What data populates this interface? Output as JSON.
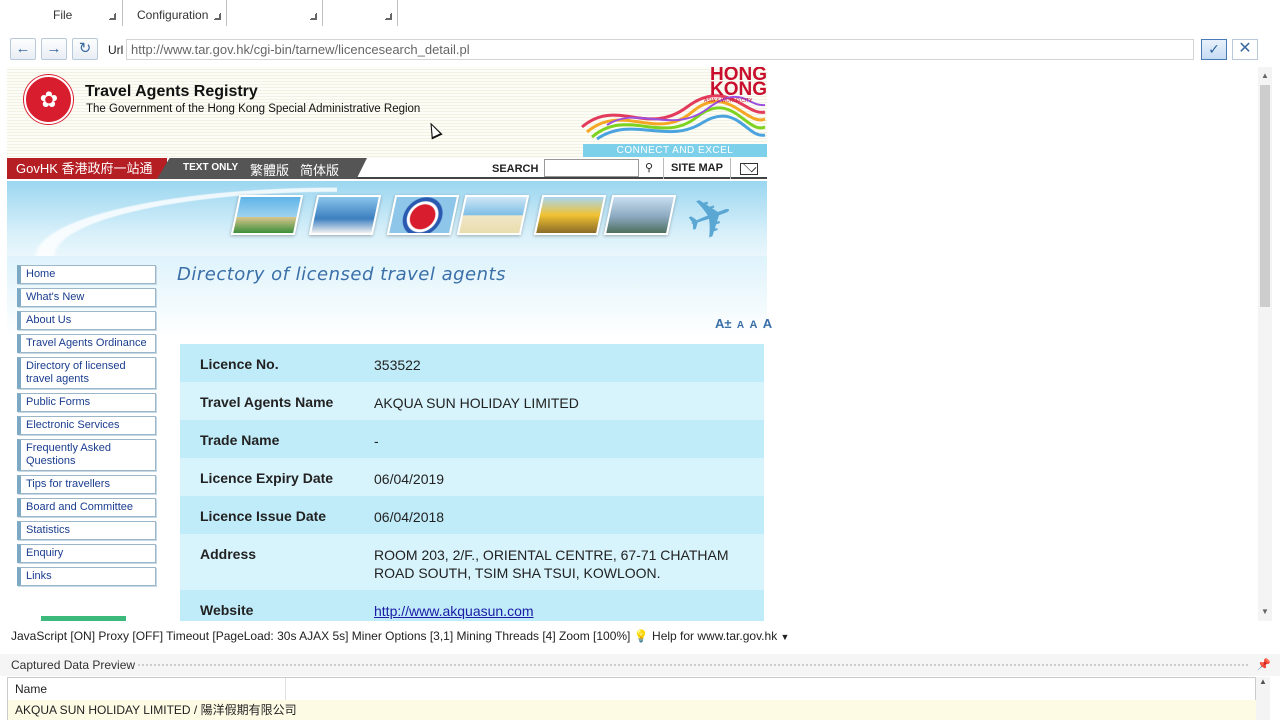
{
  "ribbon": {
    "tabs": [
      "File",
      "Configuration",
      "",
      ""
    ]
  },
  "address_bar": {
    "url_label": "Url",
    "url": "http://www.tar.gov.hk/cgi-bin/tarnew/licencesearch_detail.pl",
    "back_icon": "arrow-left-icon",
    "forward_icon": "arrow-right-icon",
    "refresh_icon": "refresh-icon"
  },
  "site": {
    "title": "Travel Agents Registry",
    "subtitle": "The Government of the Hong Kong Special Administrative Region",
    "brand_line1": "HONG",
    "brand_line2": "KONG",
    "brand_tag": "ASIA'S WORLD CITY",
    "connect": "CONNECT AND EXCEL",
    "govhk": "GovHK 香港政府一站通",
    "text_only": "TEXT ONLY",
    "traditional": "繁體版",
    "simplified": "简体版",
    "search_label": "SEARCH",
    "search_value": "",
    "sitemap": "SITE MAP"
  },
  "nav": [
    "Home",
    "What's New",
    "About Us",
    "Travel Agents Ordinance",
    "Directory of licensed travel agents",
    "Public Forms",
    "Electronic Services",
    "Frequently Asked Questions",
    "Tips for travellers",
    "Board and Committee",
    "Statistics",
    "Enquiry",
    "Links"
  ],
  "page_title": "Directory of licensed travel agents",
  "font_size_controls": {
    "plus": "A±",
    "small": "A",
    "medium": "A",
    "large": "A"
  },
  "details": [
    {
      "key": "Licence No.",
      "value": "353522"
    },
    {
      "key": "Travel Agents Name",
      "value": "AKQUA SUN HOLIDAY LIMITED"
    },
    {
      "key": "Trade Name",
      "value": "-"
    },
    {
      "key": "Licence Expiry Date",
      "value": "06/04/2019"
    },
    {
      "key": "Licence Issue Date",
      "value": "06/04/2018"
    },
    {
      "key": "Address",
      "value": "ROOM 203, 2/F., ORIENTAL CENTRE, 67-71 CHATHAM ROAD SOUTH, TSIM SHA TSUI, KOWLOON."
    },
    {
      "key": "Website",
      "value": "http://www.akquasun.com"
    }
  ],
  "status_bar": {
    "text": "JavaScript [ON] Proxy [OFF] Timeout [PageLoad: 30s AJAX 5s] Miner Options [3,1] Mining Threads [4] Zoom [100%]",
    "help": "Help for www.tar.gov.hk"
  },
  "captured": {
    "title": "Captured Data Preview",
    "column": "Name",
    "row": "AKQUA SUN HOLIDAY LIMITED / 陽洋假期有限公司"
  }
}
